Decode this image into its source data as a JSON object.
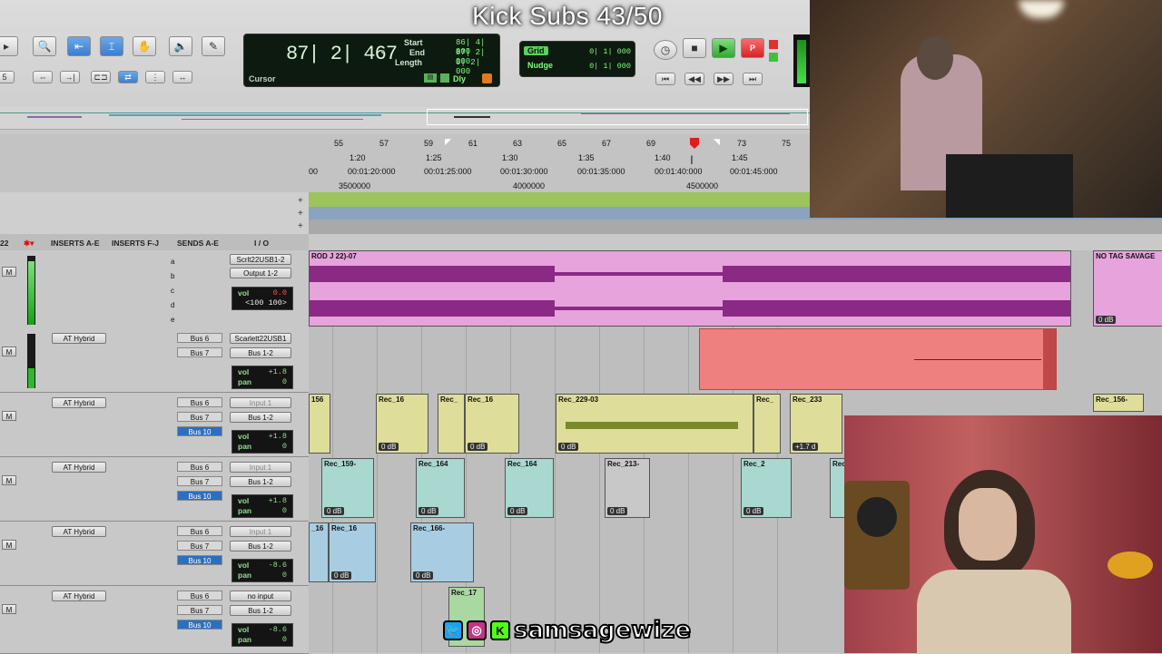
{
  "overlay_title": "Kick Subs 43/50",
  "counter": {
    "main": "87| 2| 467",
    "cursor_label": "Cursor",
    "start_label": "Start",
    "end_label": "End",
    "length_label": "Length",
    "start_val": "86| 4| 000",
    "end_val": "87| 2| 000",
    "length_val": "0| 2| 000",
    "dly_label": "Dly"
  },
  "grid": {
    "grid_label": "Grid",
    "grid_val": "0| 1| 000",
    "nudge_label": "Nudge",
    "nudge_val": "0| 1| 000"
  },
  "ruler": {
    "bars": [
      "55",
      "57",
      "59",
      "61",
      "63",
      "65",
      "67",
      "69",
      "73",
      "75"
    ],
    "minsec": [
      "1:20",
      "1:25",
      "1:30",
      "1:35",
      "1:40",
      "1:45"
    ],
    "timecode": [
      "00",
      "00:01:20:000",
      "00:01:25:000",
      "00:01:30:000",
      "00:01:35:000",
      "00:01:40:000",
      "00:01:45:000"
    ],
    "samples": [
      "3500000",
      "4000000",
      "4500000"
    ]
  },
  "columns": {
    "inserts_ae": "INSERTS A-E",
    "inserts_fj": "INSERTS F-J",
    "sends_ae": "SENDS A-E",
    "io": "I / O"
  },
  "track_number": "22",
  "tracks": [
    {
      "insert": "",
      "sends": [
        "a",
        "b",
        "c",
        "d",
        "e"
      ],
      "io_in": "Scrlt22USB1-2",
      "io_out": "Output 1-2",
      "vol": "0.0",
      "pan": "<100  100>"
    },
    {
      "insert": "AT Hybrid",
      "send_a": "Bus 6",
      "send_b": "Bus 7",
      "send_c": "",
      "io_in": "Scarlett22USB1",
      "io_out": "Bus 1-2",
      "vol": "+1.8",
      "pan": "0"
    },
    {
      "insert": "AT Hybrid",
      "send_a": "Bus 6",
      "send_b": "Bus 7",
      "send_c": "Bus 10",
      "io_in": "Input 1",
      "io_out": "Bus 1-2",
      "vol": "+1.8",
      "pan": "0"
    },
    {
      "insert": "AT Hybrid",
      "send_a": "Bus 6",
      "send_b": "Bus 7",
      "send_c": "Bus 10",
      "io_in": "Input 1",
      "io_out": "Bus 1-2",
      "vol": "+1.8",
      "pan": "0"
    },
    {
      "insert": "AT Hybrid",
      "send_a": "Bus 6",
      "send_b": "Bus 7",
      "send_c": "Bus 10",
      "io_in": "Input 1",
      "io_out": "Bus 1-2",
      "vol": "-8.6",
      "pan": "0"
    },
    {
      "insert": "AT Hybrid",
      "send_a": "Bus 6",
      "send_b": "Bus 7",
      "send_c": "Bus 10",
      "io_in": "no input",
      "io_out": "Bus 1-2",
      "vol": "-8.6",
      "pan": "0"
    }
  ],
  "labels": {
    "vol": "vol",
    "pan": "pan",
    "m": "M"
  },
  "clips": {
    "beat": "ROD J 22)-07",
    "beat2": "NO TAG SAVAGE",
    "zero_db": "0 dB",
    "c3": [
      "156",
      "Rec_16",
      "Rec_",
      "Rec_16",
      "Rec_229-03",
      "Rec_",
      "Rec_233",
      "Rec_156-"
    ],
    "c3_gain": "+1.7 d",
    "c4": [
      "Rec_159-",
      "Rec_164",
      "Rec_164",
      "Rec_213-",
      "Rec_2",
      "Rec"
    ],
    "c5": [
      "_16",
      "Rec_16",
      "Rec_166-"
    ],
    "c6": [
      "Rec_17"
    ]
  },
  "social": {
    "handle": "samsagewize"
  },
  "colors": {
    "beat_clip": "#e7a3dc",
    "red_clip": "#ef8080",
    "yellow_clip": "#dede9a",
    "teal_clip": "#a9d8d0",
    "blue_clip": "#a8cde2"
  }
}
